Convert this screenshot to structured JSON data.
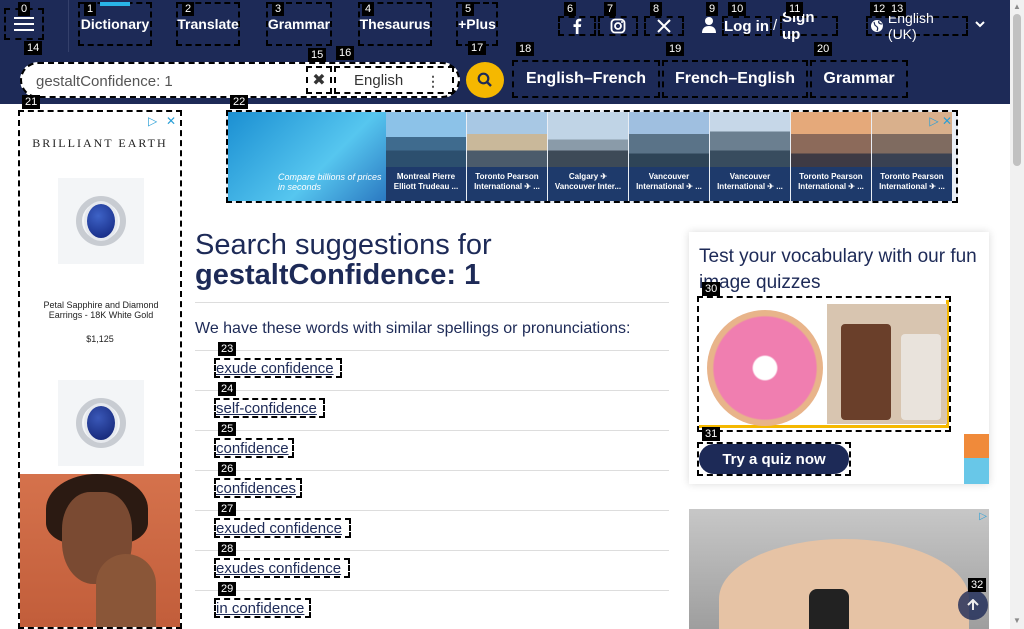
{
  "nav": {
    "links": [
      "Dictionary",
      "Translate",
      "Grammar",
      "Thesaurus",
      "+Plus"
    ],
    "login": "Log in",
    "slash": "/",
    "signup": "Sign up",
    "language": "English (UK)"
  },
  "search": {
    "value": "gestaltConfidence: 1",
    "dictionary": "English",
    "clear_glyph": "✖"
  },
  "subnav": [
    "English–French",
    "French–English",
    "Grammar"
  ],
  "badges": [
    "0",
    "1",
    "2",
    "3",
    "4",
    "5",
    "6",
    "7",
    "8",
    "9",
    "10",
    "11",
    "12",
    "13",
    "14",
    "15",
    "16",
    "17",
    "18",
    "19",
    "20",
    "21",
    "22",
    "23",
    "24",
    "25",
    "26",
    "27",
    "28",
    "29",
    "30",
    "31",
    "32"
  ],
  "left_ad": {
    "brand": "BRILLIANT EARTH",
    "caption": "Petal Sapphire and Diamond Earrings - 18K White Gold",
    "price": "$1,125"
  },
  "banner": {
    "hero_text": "Compare billions of prices in seconds",
    "destinations": [
      "Montreal Pierre Elliott Trudeau ...",
      "Toronto Pearson International ✈ ...",
      "Calgary ✈ Vancouver Inter...",
      "Vancouver International ✈ ...",
      "Vancouver International ✈ ...",
      "Toronto Pearson International ✈ ...",
      "Toronto Pearson International ✈ ..."
    ]
  },
  "main": {
    "headline_prefix": "Search suggestions for",
    "headline_query": "gestaltConfidence: 1",
    "intro": "We have these words with similar spellings or pronunciations:",
    "suggestions": [
      "exude confidence",
      "self-confidence",
      "confidence",
      "confidences",
      "exuded confidence",
      "exudes confidence",
      "in confidence"
    ]
  },
  "quiz": {
    "title": "Test your vocabulary with our fun image quizzes",
    "button": "Try a quiz now"
  },
  "colors": {
    "nav_bg": "#1d2a57",
    "accent_yellow": "#f5b800",
    "accent_blue": "#29b4e8"
  },
  "icons": [
    "hamburger-icon",
    "facebook-icon",
    "instagram-icon",
    "x-icon",
    "user-icon",
    "globe-icon",
    "chevron-down-icon",
    "clear-icon",
    "kebab-icon",
    "search-icon",
    "ad-choices-icon",
    "arrow-up-icon"
  ]
}
